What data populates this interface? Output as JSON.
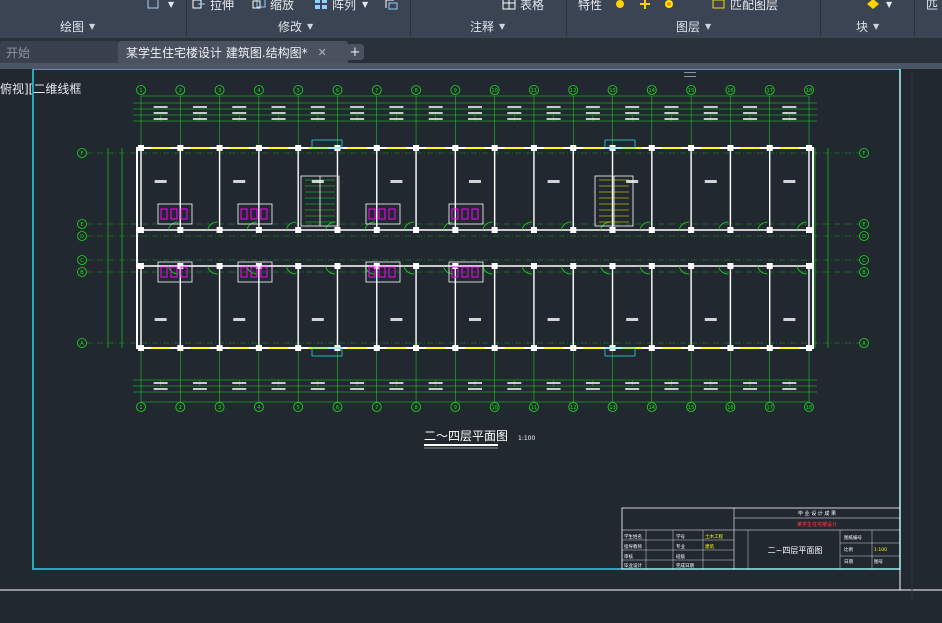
{
  "ribbon": {
    "tools": [
      {
        "label": "",
        "icon": "measure-icon"
      },
      {
        "label": "拉伸",
        "icon": "stretch-icon"
      },
      {
        "label": "缩放",
        "icon": "scale-icon"
      },
      {
        "label": "阵列",
        "icon": "array-icon"
      },
      {
        "label": "",
        "icon": "copy-clip-icon"
      },
      {
        "label": "表格",
        "icon": "table-icon"
      },
      {
        "label": "特性",
        "icon": "properties-icon"
      },
      {
        "label": "",
        "icon": "layer-state-icon"
      },
      {
        "label": "",
        "icon": "layer-freeze-icon"
      },
      {
        "label": "",
        "icon": "layer-off-icon"
      },
      {
        "label": "匹配图层",
        "icon": "match-layer-icon"
      },
      {
        "label": "",
        "icon": "block-insert-icon"
      },
      {
        "label": "匹",
        "icon": ""
      }
    ],
    "panels": [
      "绘图",
      "修改",
      "注释",
      "图层",
      "块"
    ]
  },
  "tabs": {
    "start": "开始",
    "document": "某学生住宅楼设计 建筑图.结构图*",
    "close": "✕",
    "add": "+"
  },
  "viewport_label": "俯视][二维线框",
  "drawing": {
    "title": "二～四层平面图",
    "scale": "1:100",
    "column_axes": [
      "1",
      "2",
      "3",
      "4",
      "5",
      "6",
      "7",
      "8",
      "9",
      "10",
      "11",
      "12",
      "13",
      "14",
      "15",
      "16",
      "17",
      "18"
    ],
    "row_axes": [
      "F",
      "E",
      "D",
      "C",
      "B",
      "A"
    ]
  },
  "title_block": {
    "project_header": "毕 业 设 计 成 果",
    "subtitle": "某学生住宅楼设计",
    "sheet_name": "二~四层平面图",
    "left_labels": [
      "学生姓名",
      "指导教师",
      "审核",
      "毕业设计"
    ],
    "mid_labels": [
      "学号",
      "专业",
      "班级",
      "完成日期"
    ],
    "right_labels": [
      "图纸编号",
      "比例",
      "日期",
      "图号"
    ],
    "values": [
      "土木工程",
      "建筑",
      "1:100"
    ]
  },
  "colors": {
    "ribbon_bg": "#3b4453",
    "canvas_bg": "#212830",
    "cyan": "#22d6e6",
    "green": "#19e319",
    "magenta": "#ff00ff",
    "yellow": "#ffff00",
    "white": "#ffffff"
  }
}
